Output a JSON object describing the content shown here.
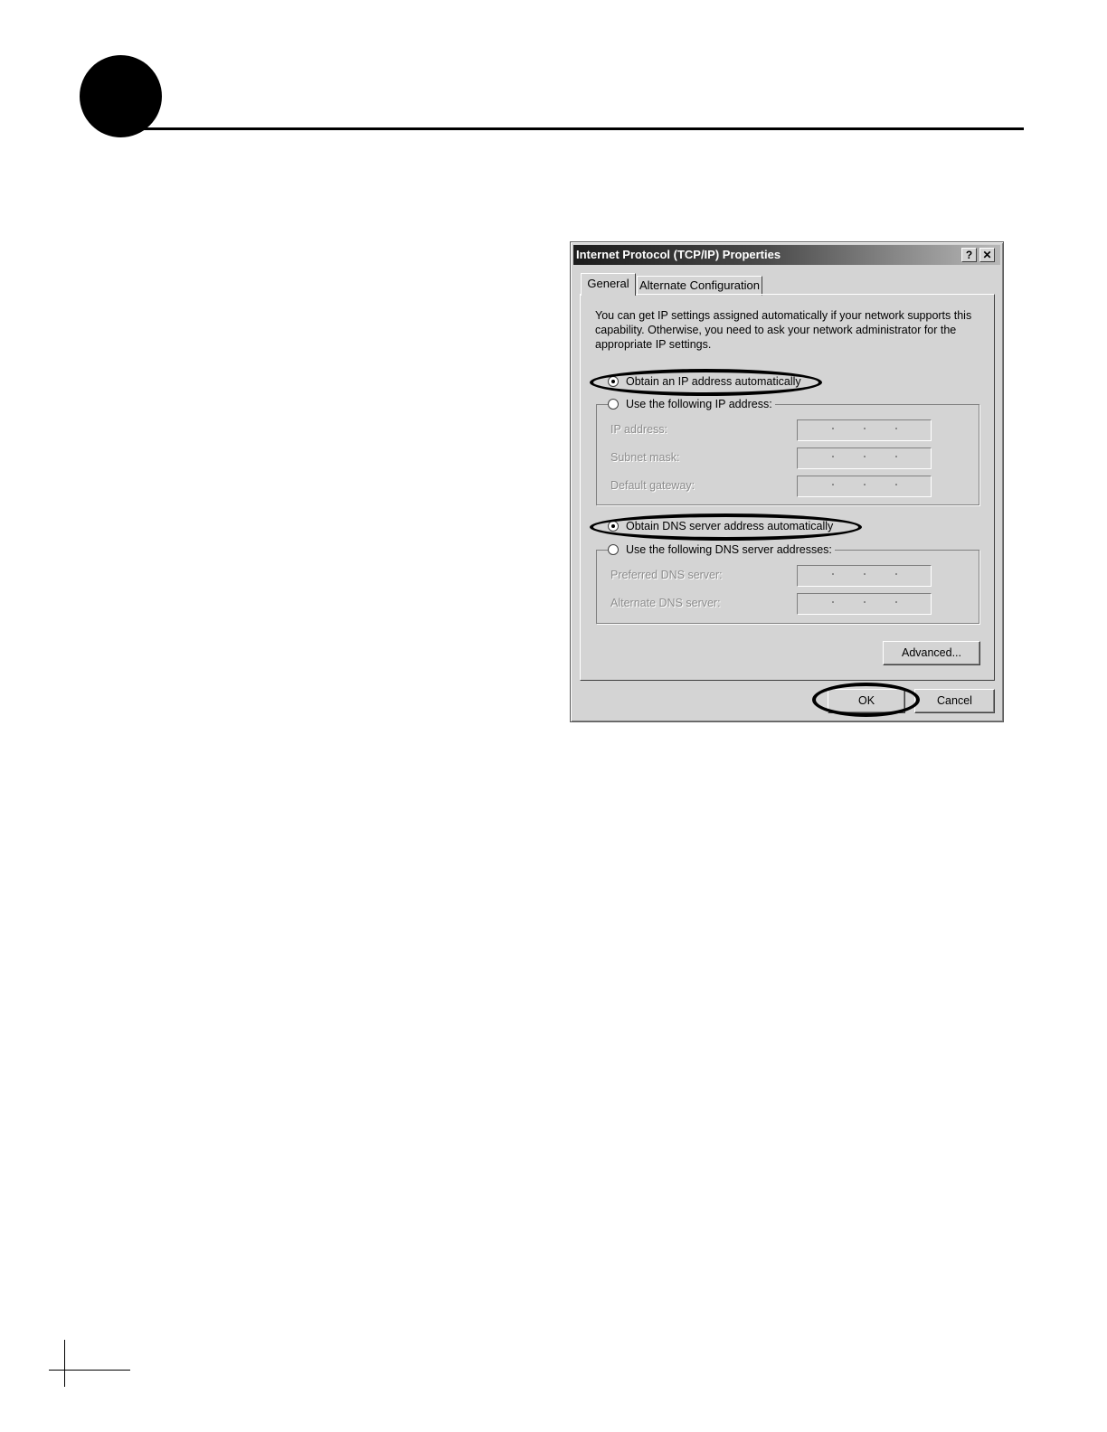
{
  "dialog": {
    "title": "Internet Protocol (TCP/IP) Properties",
    "help_label": "?",
    "close_label": "✕",
    "tabs": [
      {
        "label": "General",
        "active": true
      },
      {
        "label": "Alternate Configuration",
        "active": false
      }
    ],
    "intro": "You can get IP settings assigned automatically if your network supports this capability. Otherwise, you need to ask your network administrator for the appropriate IP settings.",
    "ip": {
      "auto_label": "Obtain an IP address automatically",
      "auto_selected": true,
      "manual_label": "Use the following IP address:",
      "fields": [
        {
          "label": "IP address:",
          "value": ""
        },
        {
          "label": "Subnet mask:",
          "value": ""
        },
        {
          "label": "Default gateway:",
          "value": ""
        }
      ]
    },
    "dns": {
      "auto_label": "Obtain DNS server address automatically",
      "auto_selected": true,
      "manual_label": "Use the following DNS server addresses:",
      "fields": [
        {
          "label": "Preferred DNS server:",
          "value": ""
        },
        {
          "label": "Alternate DNS server:",
          "value": ""
        }
      ]
    },
    "buttons": {
      "advanced": "Advanced...",
      "ok": "OK",
      "cancel": "Cancel"
    }
  }
}
